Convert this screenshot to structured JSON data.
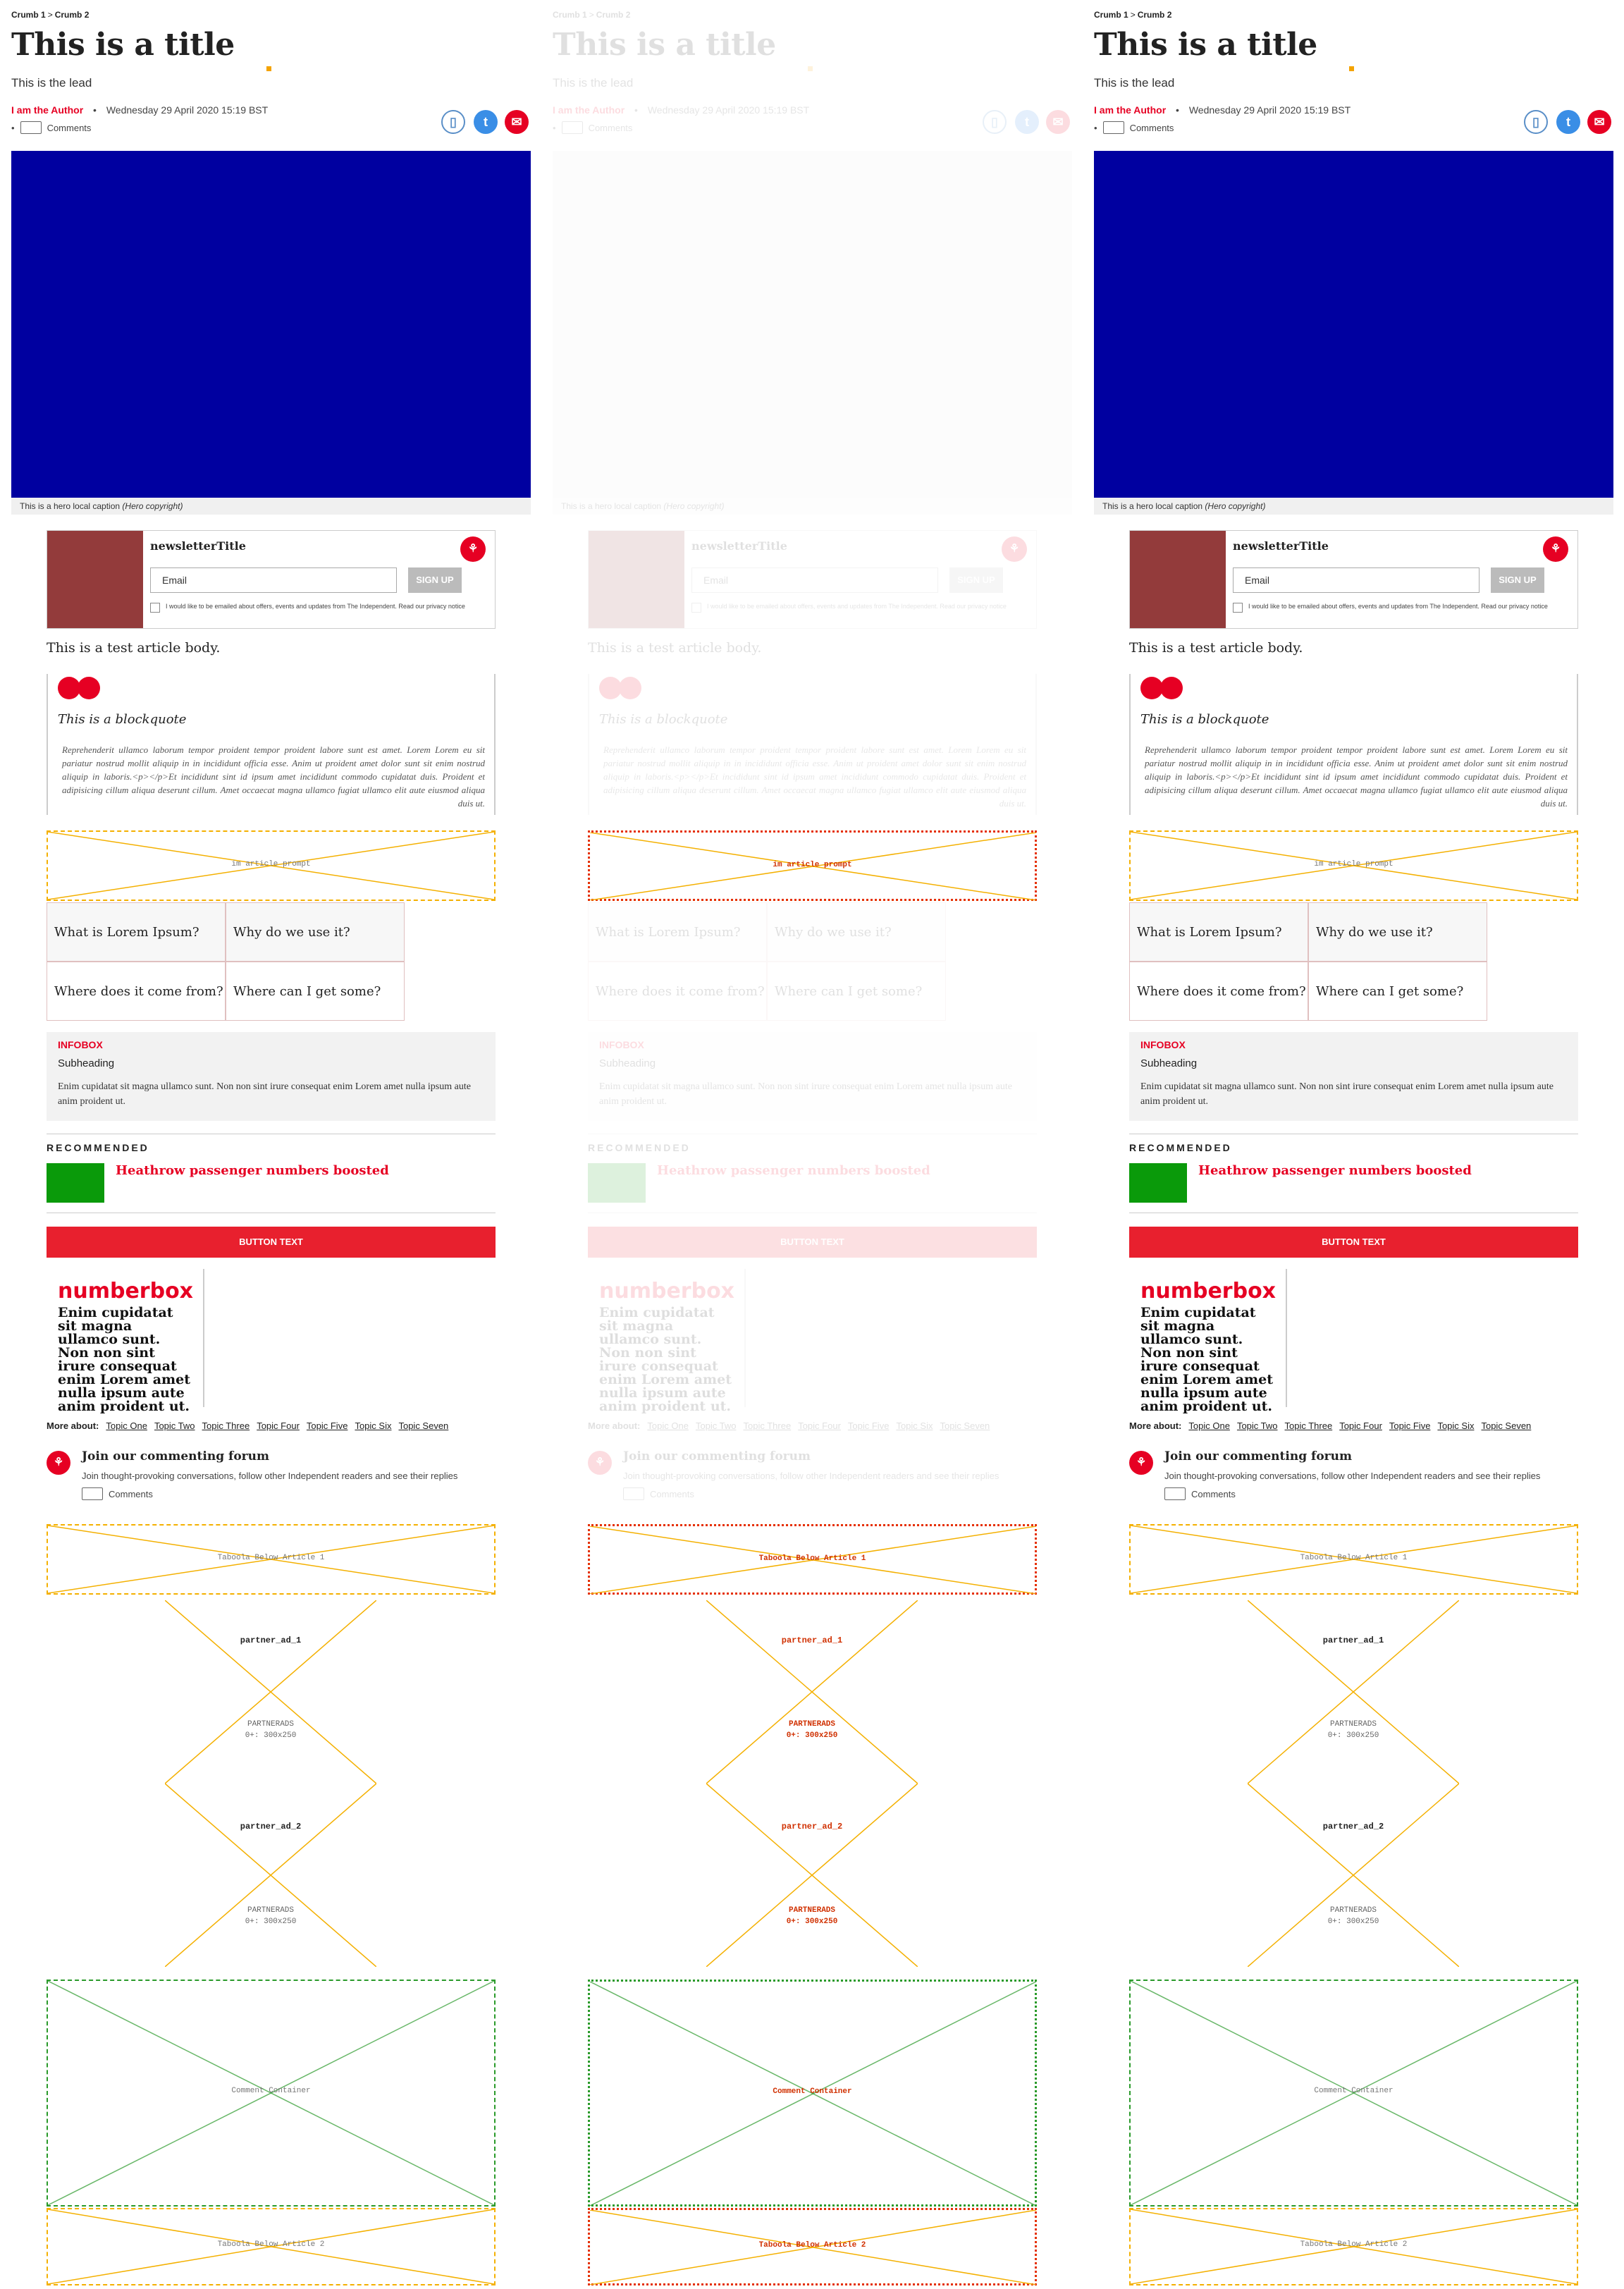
{
  "article": {
    "crumbs": [
      "Crumb 1",
      "Crumb 2"
    ],
    "crumb_separator": ">",
    "title": "This is a title",
    "lead": "This is the lead",
    "author": "I am the Author",
    "date": "Wednesday 29 April 2020 15:19 BST",
    "comments_label": "Comments",
    "hero_caption": "This is a hero local caption",
    "hero_credit": "(Hero copyright)",
    "body": "This is a test article body."
  },
  "newsletter": {
    "title": "newsletterTitle",
    "email_placeholder": "Email",
    "signup_label": "SIGN UP",
    "consent": "I would like to be emailed about offers, events and updates from The Independent. Read our privacy notice"
  },
  "blockquote": {
    "title": "This is a blockquote",
    "text": "Reprehenderit ullamco laborum tempor proident tempor proident labore sunt est amet. Lorem Lorem eu sit pariatur nostrud mollit aliquip in in incididunt officia esse. Anim ut proident amet dolor sunt sit enim nostrud aliquip in laboris.<p></p>Et incididunt sint id ipsum amet incididunt commodo cupidatat duis. Proident et adipisicing cillum aliqua deserunt cillum. Amet occaecat magna ullamco fugiat ullamco elit aute eiusmod aliqua duis ut."
  },
  "placeholders": {
    "in_article_prompt": "im article prompt",
    "taboola_1": "Taboola Below Article 1",
    "taboola_2": "Taboola Below Article 2",
    "partner_1": "partner_ad_1",
    "partner_2": "partner_ad_2",
    "partner_sub": "PARTNERADS",
    "partner_size": "0+: 300x250",
    "comment_container": "Comment Container"
  },
  "faq": [
    "What is Lorem Ipsum?",
    "Why do we use it?",
    "Where does it come from?",
    "Where can I get some?"
  ],
  "infobox": {
    "label": "INFOBOX",
    "subheading": "Subheading",
    "text": "Enim cupidatat sit magna ullamco sunt. Non non sint irure consequat enim Lorem amet nulla ipsum aute anim proident ut."
  },
  "recommended": {
    "label": "RECOMMENDED",
    "headline": "Heathrow passenger numbers boosted"
  },
  "cta": {
    "label": "BUTTON TEXT"
  },
  "numberbox": {
    "title": "numberbox",
    "text": "Enim cupidatat sit magna ullamco sunt. Non non sint irure consequat enim Lorem amet nulla ipsum aute anim proident ut."
  },
  "topics": {
    "label": "More about:",
    "items": [
      "Topic One",
      "Topic Two",
      "Topic Three",
      "Topic Four",
      "Topic Five",
      "Topic Six",
      "Topic Seven"
    ]
  },
  "forum": {
    "title": "Join our commenting forum",
    "text": "Join thought-provoking conversations, follow other Independent readers and see their replies",
    "comments_label": "Comments"
  },
  "colors": {
    "brand_red": "#e60023",
    "hero_blue": "#0000a0",
    "placeholder_orange": "#f4b000",
    "comment_green": "#2a9a2a"
  },
  "icons": [
    "bookmark-icon",
    "twitter-icon",
    "email-icon",
    "independent-eagle-icon",
    "comment-bubble-icon",
    "quote-icon"
  ]
}
